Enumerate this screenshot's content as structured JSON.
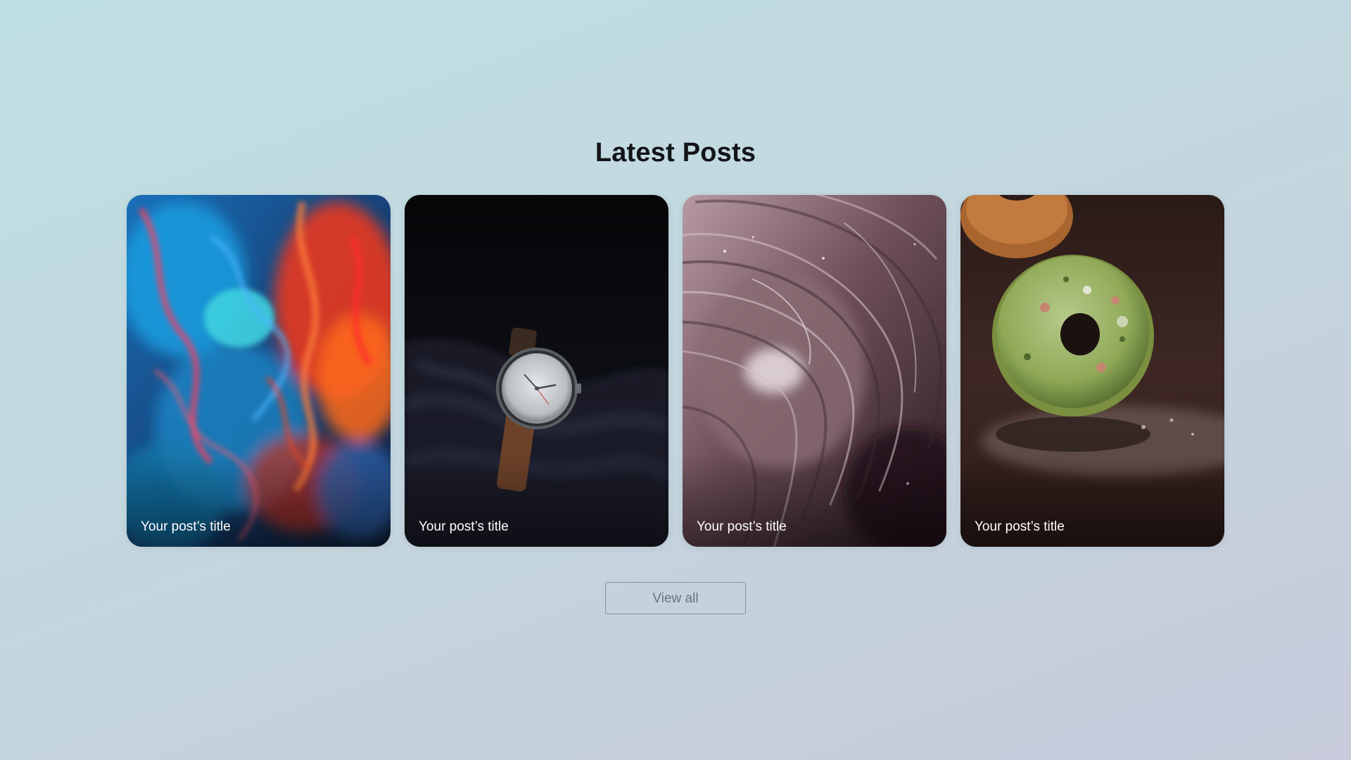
{
  "section": {
    "heading": "Latest Posts",
    "posts": [
      {
        "title": "Your post’s title",
        "image": "colorful-ink-smoke-image"
      },
      {
        "title": "Your post’s title",
        "image": "wristwatch-on-fabric-image"
      },
      {
        "title": "Your post’s title",
        "image": "marbled-swirl-image"
      },
      {
        "title": "Your post’s title",
        "image": "pistachio-donut-image"
      }
    ],
    "view_all_label": "View all"
  },
  "colors": {
    "background_start": "#bfe0e3",
    "background_end": "#c7cbdb",
    "heading": "#121418",
    "card_title": "#ffffff",
    "button_border": "#8b9198",
    "button_text": "#6d737a"
  }
}
